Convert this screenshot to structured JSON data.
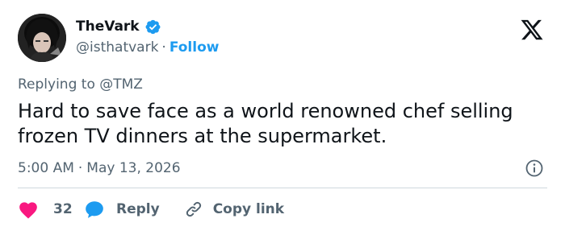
{
  "tweet": {
    "author": {
      "display_name": "TheVark",
      "handle": "@isthatvark",
      "separator": "·",
      "follow_label": "Follow",
      "verified": true
    },
    "reply_context": {
      "prefix": "Replying to",
      "mention": "@TMZ"
    },
    "text": "Hard to save face as a world renowned chef selling frozen TV dinners at the supermarket.",
    "timestamp": {
      "time": "5:00 AM",
      "separator": "·",
      "date": "May 13, 2026"
    },
    "actions": {
      "like_count": "32",
      "reply_label": "Reply",
      "copy_link_label": "Copy link"
    }
  },
  "colors": {
    "text_primary": "#0f1419",
    "text_secondary": "#536471",
    "accent": "#1d9bf0",
    "like": "#f91880",
    "divider": "#cfd9de"
  },
  "icons": [
    "avatar",
    "verified-badge-icon",
    "x-logo-icon",
    "info-icon",
    "heart-icon",
    "comment-icon",
    "link-icon"
  ]
}
